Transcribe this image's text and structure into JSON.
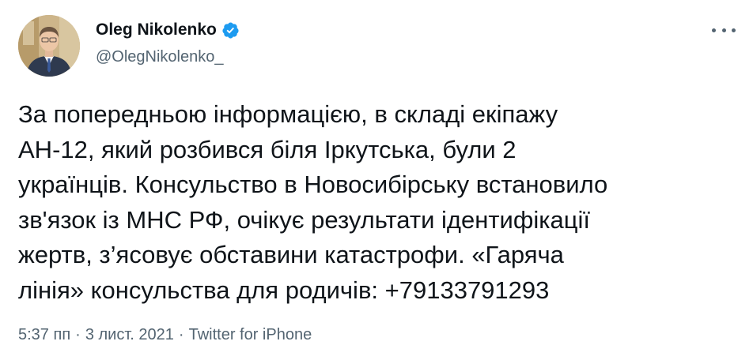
{
  "author": {
    "display_name": "Oleg Nikolenko",
    "handle": "@OlegNikolenko_",
    "verified": true,
    "verified_icon": "verified-badge-icon",
    "verified_color": "#1d9bf0"
  },
  "tweet": {
    "text": "За попередньою інформацією, в складі екіпажу\nАН-12, який розбився біля Іркутська, були 2\nукраїнців. Консульство в Новосибірську встановило\nзв'язок із МНС РФ, очікує результати ідентифікації\nжертв, з’ясовує обставини катастрофи. «Гаряча\nлінія» консульства для родичів: +79133791293"
  },
  "meta": {
    "time": "5:37 пп",
    "separator": "·",
    "date": "3 лист. 2021",
    "source": "Twitter for iPhone"
  },
  "icons": {
    "more": "more-options-icon"
  },
  "colors": {
    "text": "#0f1419",
    "secondary": "#536471",
    "accent": "#1d9bf0"
  }
}
